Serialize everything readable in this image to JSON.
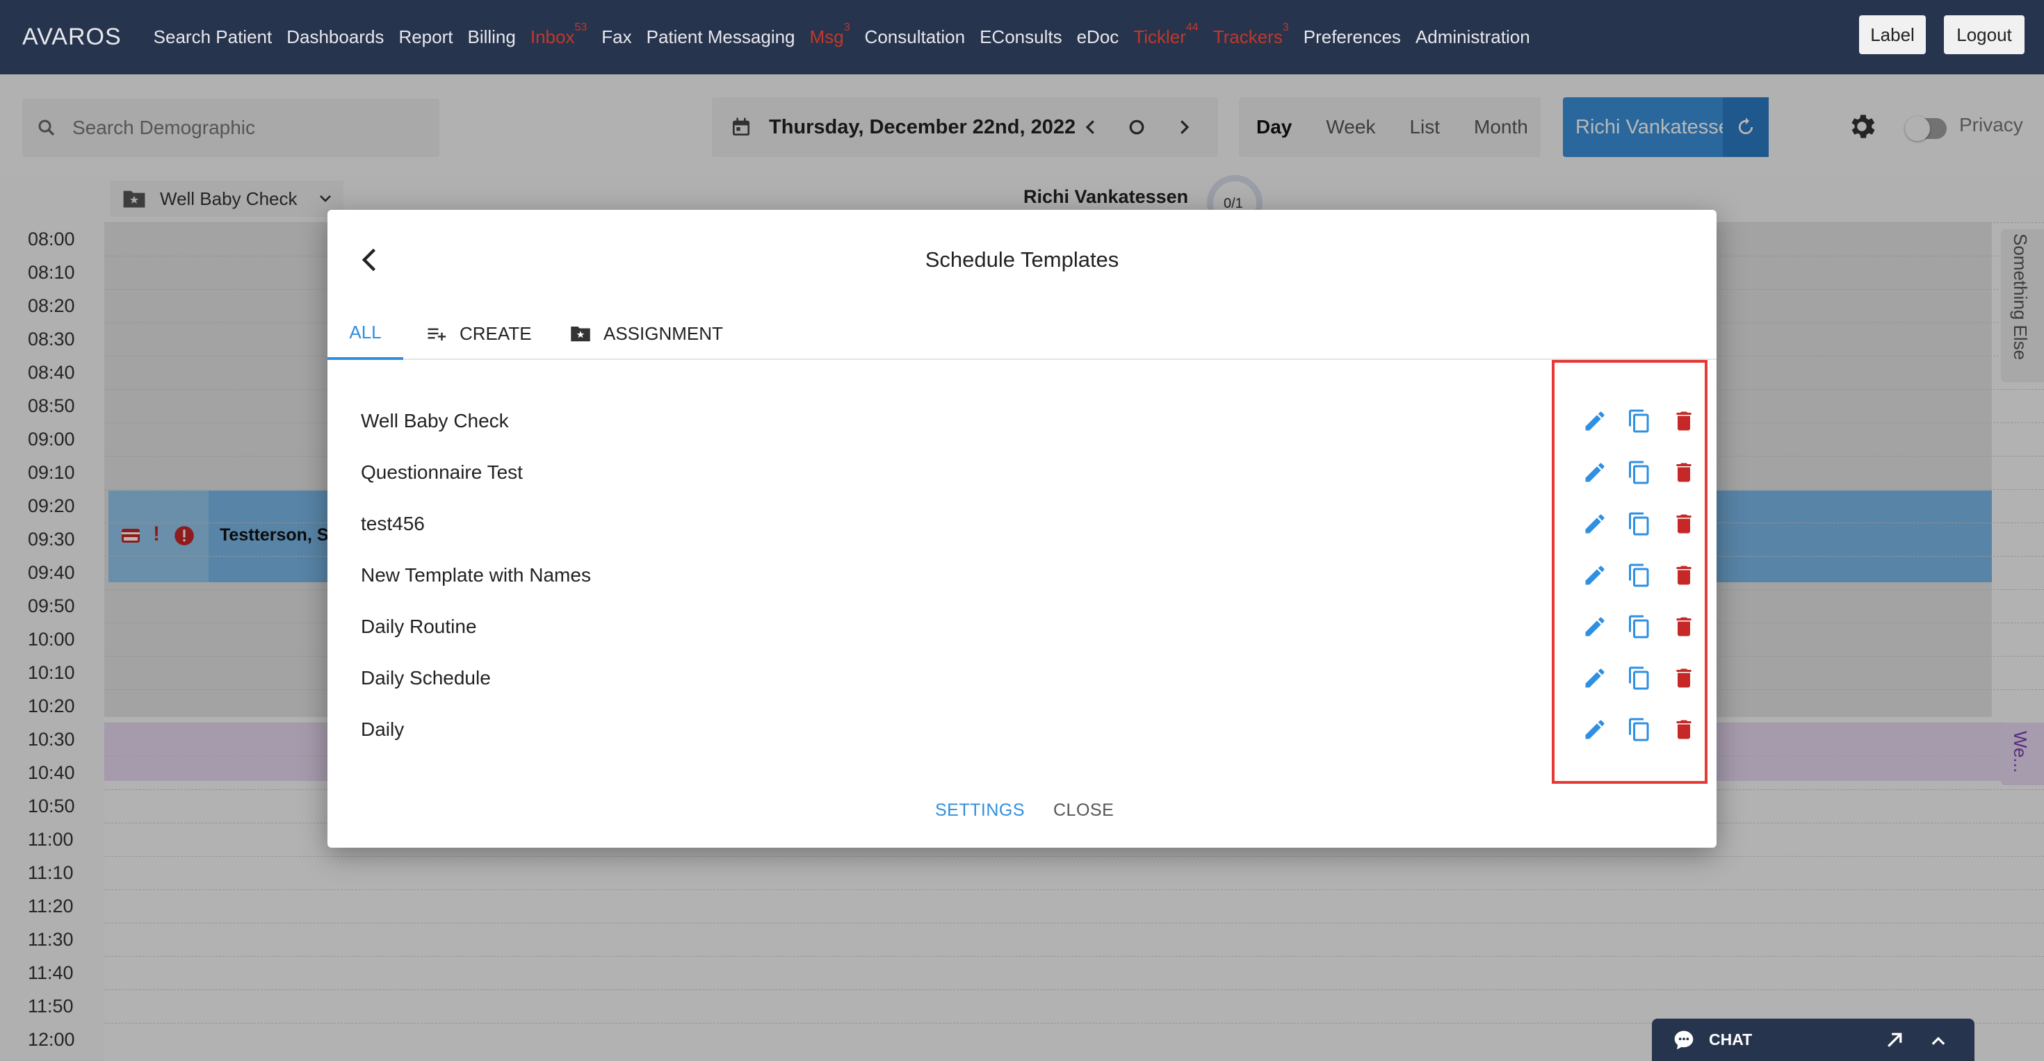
{
  "app": {
    "brand": "AVAROS"
  },
  "nav": {
    "items": [
      {
        "label": "Search Patient",
        "badge": "",
        "alert": false
      },
      {
        "label": "Dashboards",
        "badge": "",
        "alert": false
      },
      {
        "label": "Report",
        "badge": "",
        "alert": false
      },
      {
        "label": "Billing",
        "badge": "",
        "alert": false
      },
      {
        "label": "Inbox",
        "badge": "53",
        "alert": true
      },
      {
        "label": "Fax",
        "badge": "",
        "alert": false
      },
      {
        "label": "Patient Messaging",
        "badge": "",
        "alert": false
      },
      {
        "label": "Msg",
        "badge": "3",
        "alert": true
      },
      {
        "label": "Consultation",
        "badge": "",
        "alert": false
      },
      {
        "label": "EConsults",
        "badge": "",
        "alert": false
      },
      {
        "label": "eDoc",
        "badge": "",
        "alert": false
      },
      {
        "label": "Tickler",
        "badge": "44",
        "alert": true
      },
      {
        "label": "Trackers",
        "badge": "3",
        "alert": true
      },
      {
        "label": "Preferences",
        "badge": "",
        "alert": false
      },
      {
        "label": "Administration",
        "badge": "",
        "alert": false
      }
    ],
    "label_button": "Label",
    "logout_button": "Logout"
  },
  "toolbar": {
    "search_placeholder": "Search Demographic",
    "date": "Thursday, December 22nd, 2022",
    "views": [
      "Day",
      "Week",
      "List",
      "Month"
    ],
    "active_view": "Day",
    "provider": "Richi Vankatessen",
    "privacy_label": "Privacy"
  },
  "schedule": {
    "template_label": "Well Baby Check",
    "provider_name": "Richi Vankatessen",
    "counter": "0/1",
    "times": [
      "08:00",
      "08:10",
      "08:20",
      "08:30",
      "08:40",
      "08:50",
      "09:00",
      "09:10",
      "09:20",
      "09:30",
      "09:40",
      "09:50",
      "10:00",
      "10:10",
      "10:20",
      "10:30",
      "10:40",
      "10:50",
      "11:00",
      "11:10",
      "11:20",
      "11:30",
      "11:40",
      "11:50",
      "12:00"
    ],
    "appointment_name": "Testterson, SE",
    "side_tab_1": "Something Else",
    "side_tab_2": "We..."
  },
  "modal": {
    "title": "Schedule Templates",
    "tabs": {
      "all": "ALL",
      "create": "CREATE",
      "assignment": "ASSIGNMENT"
    },
    "templates": [
      "Well Baby Check",
      "Questionnaire Test",
      "test456",
      "New Template with Names",
      "Daily Routine",
      "Daily Schedule",
      "Daily"
    ],
    "settings_button": "SETTINGS",
    "close_button": "CLOSE"
  },
  "chat": {
    "label": "CHAT"
  },
  "colors": {
    "nav_bg": "#26344d",
    "accent_blue": "#2f8fe0",
    "alert_red": "#c0392b",
    "delete_red": "#c62828",
    "highlight_red": "#e53935"
  }
}
